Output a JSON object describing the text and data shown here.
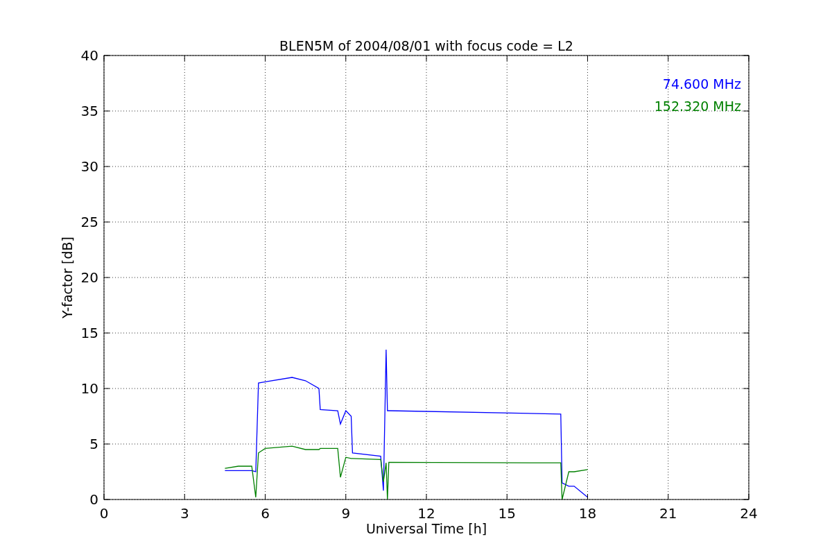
{
  "chart_data": {
    "type": "line",
    "title": "BLEN5M of 2004/08/01 with focus code = L2",
    "xlabel": "Universal Time [h]",
    "ylabel": "Y-factor [dB]",
    "grid": true,
    "x": [
      4.5,
      5.0,
      5.5,
      5.65,
      5.75,
      6.0,
      7.0,
      7.5,
      8.0,
      8.05,
      8.7,
      8.8,
      9.0,
      9.2,
      9.25,
      10.3,
      10.4,
      10.5,
      10.55,
      10.6,
      17.0,
      17.05,
      17.3,
      17.5,
      18.0
    ],
    "series": [
      {
        "name": "74.600 MHz",
        "color": "#0000ff",
        "values": [
          2.6,
          2.6,
          2.6,
          2.5,
          10.5,
          10.6,
          11.0,
          10.7,
          10.0,
          8.1,
          8.0,
          6.8,
          8.0,
          7.5,
          4.2,
          3.9,
          0.8,
          13.5,
          8.0,
          8.0,
          7.7,
          1.5,
          1.2,
          1.2,
          0.2
        ]
      },
      {
        "name": "152.320 MHz",
        "color": "#008000",
        "values": [
          2.8,
          3.0,
          3.0,
          0.2,
          4.2,
          4.6,
          4.8,
          4.5,
          4.5,
          4.6,
          4.6,
          2.0,
          3.8,
          3.7,
          3.7,
          3.6,
          1.6,
          3.3,
          0.0,
          3.35,
          3.3,
          0.0,
          2.5,
          2.5,
          2.7
        ]
      }
    ],
    "xlim": [
      0,
      24
    ],
    "ylim": [
      0,
      40
    ],
    "xticks": [
      0,
      3,
      6,
      9,
      12,
      15,
      18,
      21,
      24
    ],
    "yticks": [
      0,
      5,
      10,
      15,
      20,
      25,
      30,
      35,
      40
    ]
  }
}
